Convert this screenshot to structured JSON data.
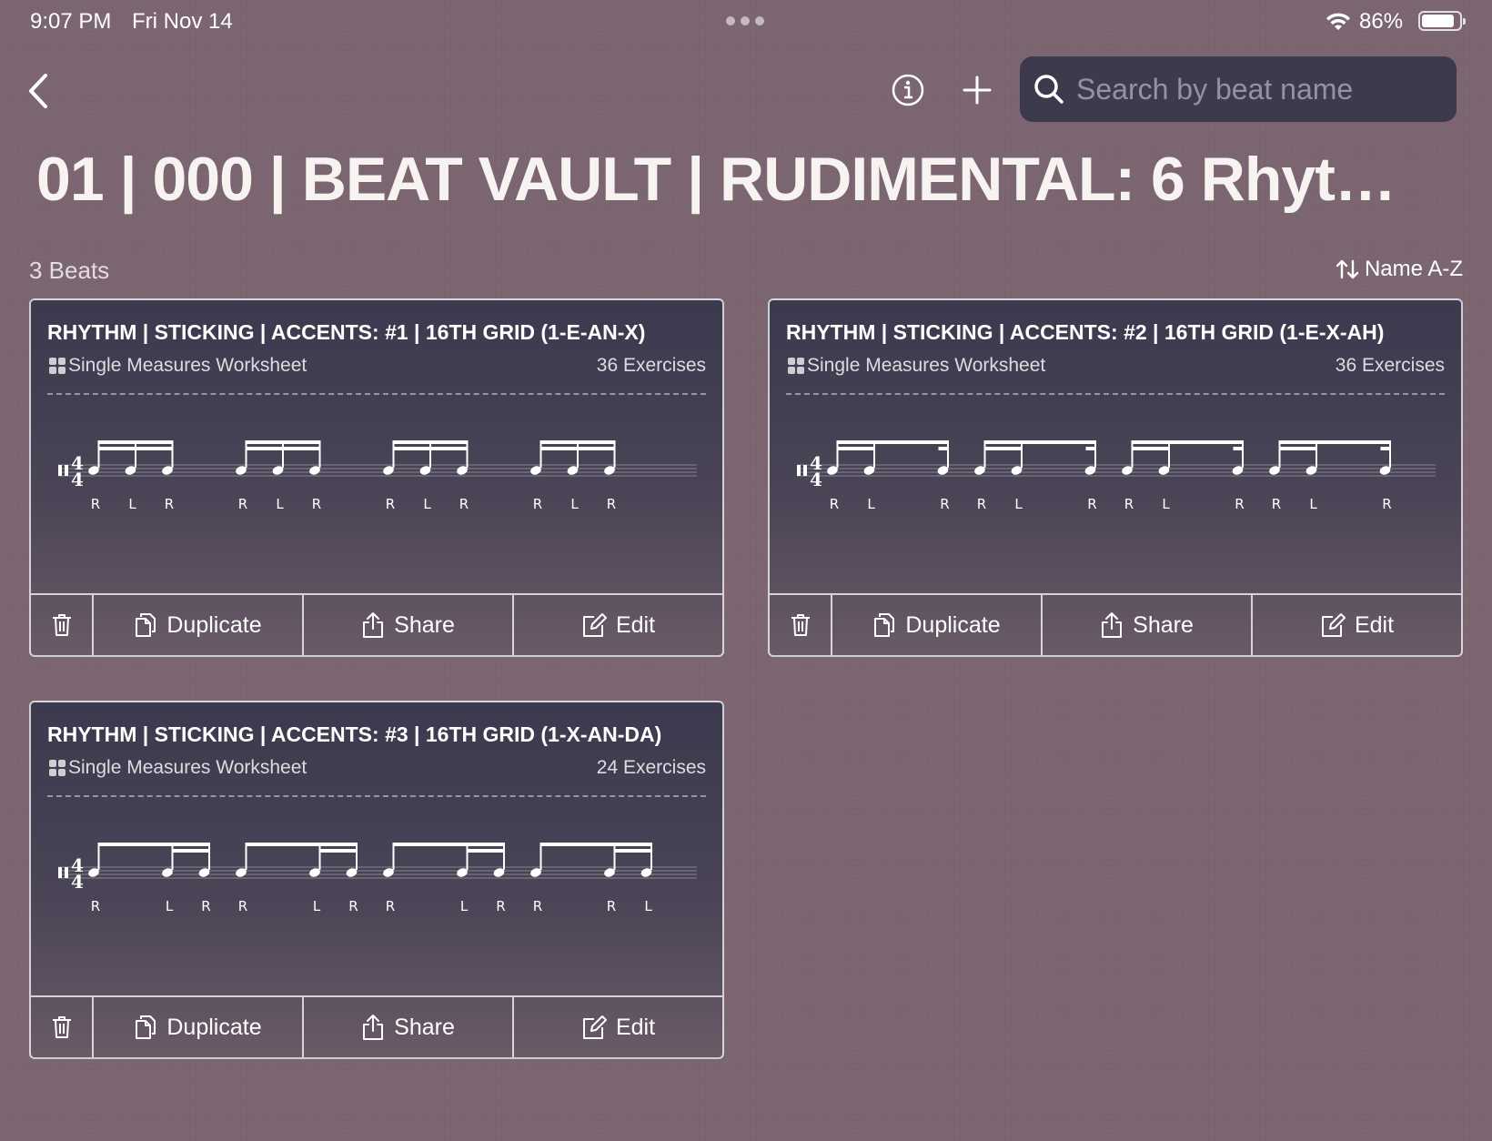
{
  "status_bar": {
    "time": "9:07 PM",
    "date": "Fri Nov 14",
    "battery": "86%"
  },
  "search": {
    "placeholder": "Search by beat name",
    "value": ""
  },
  "page_title": "01 | 000 | BEAT VAULT | RUDIMENTAL: 6 Rhythm |...",
  "beat_count": "3 Beats",
  "sort_label": "Name A-Z",
  "actions": {
    "duplicate": "Duplicate",
    "share": "Share",
    "edit": "Edit"
  },
  "time_signature": "4/4",
  "cards": [
    {
      "title": "RHYTHM | STICKING | ACCENTS: #1 | 16TH GRID (1-E-AN-X)",
      "type": "Single Measures Worksheet",
      "exercises": "36 Exercises",
      "beats": [
        {
          "onsets": [
            0,
            1,
            2
          ],
          "sticking": [
            "R",
            "L",
            "R"
          ]
        },
        {
          "onsets": [
            0,
            1,
            2
          ],
          "sticking": [
            "R",
            "L",
            "R"
          ]
        },
        {
          "onsets": [
            0,
            1,
            2
          ],
          "sticking": [
            "R",
            "L",
            "R"
          ]
        },
        {
          "onsets": [
            0,
            1,
            2
          ],
          "sticking": [
            "R",
            "L",
            "R"
          ]
        }
      ]
    },
    {
      "title": "RHYTHM | STICKING | ACCENTS: #2 | 16TH GRID (1-E-X-AH)",
      "type": "Single Measures Worksheet",
      "exercises": "36 Exercises",
      "beats": [
        {
          "onsets": [
            0,
            1,
            3
          ],
          "sticking": [
            "R",
            "L",
            "R"
          ]
        },
        {
          "onsets": [
            0,
            1,
            3
          ],
          "sticking": [
            "R",
            "L",
            "R"
          ]
        },
        {
          "onsets": [
            0,
            1,
            3
          ],
          "sticking": [
            "R",
            "L",
            "R"
          ]
        },
        {
          "onsets": [
            0,
            1,
            3
          ],
          "sticking": [
            "R",
            "L",
            "R"
          ]
        }
      ]
    },
    {
      "title": "RHYTHM | STICKING | ACCENTS: #3 | 16TH GRID (1-X-AN-DA)",
      "type": "Single Measures Worksheet",
      "exercises": "24 Exercises",
      "beats": [
        {
          "onsets": [
            0,
            2,
            3
          ],
          "sticking": [
            "R",
            "L",
            "R"
          ]
        },
        {
          "onsets": [
            0,
            2,
            3
          ],
          "sticking": [
            "R",
            "L",
            "R"
          ]
        },
        {
          "onsets": [
            0,
            2,
            3
          ],
          "sticking": [
            "R",
            "L",
            "R"
          ]
        },
        {
          "onsets": [
            0,
            2,
            3
          ],
          "sticking": [
            "R",
            "R",
            "L"
          ]
        }
      ]
    }
  ]
}
